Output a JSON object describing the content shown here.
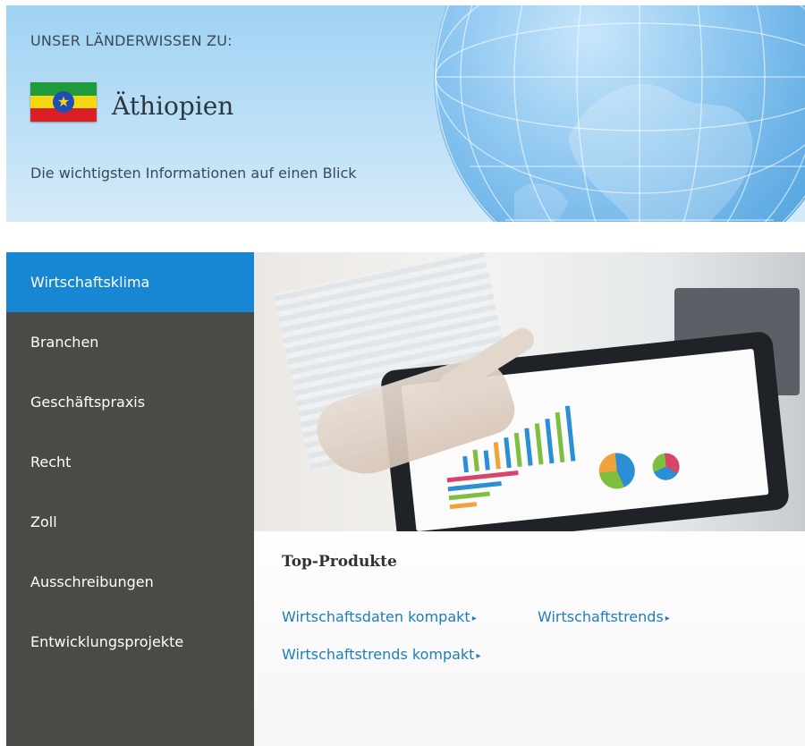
{
  "header": {
    "subheading": "UNSER LÄNDERWISSEN ZU:",
    "country": "Äthiopien",
    "tagline": "Die wichtigsten Informationen auf einen Blick",
    "flag_icon": "ethiopia-flag-icon",
    "globe_icon": "globe-icon"
  },
  "sidebar": {
    "items": [
      {
        "label": "Wirtschaftsklima",
        "active": true
      },
      {
        "label": "Branchen"
      },
      {
        "label": "Geschäftspraxis"
      },
      {
        "label": "Recht"
      },
      {
        "label": "Zoll"
      },
      {
        "label": "Ausschreibungen"
      },
      {
        "label": "Entwicklungsprojekte"
      }
    ]
  },
  "products": {
    "title": "Top-Produkte",
    "links": [
      {
        "label": "Wirtschaftsdaten kompakt",
        "arrow": "▸"
      },
      {
        "label": "Wirtschaftstrends",
        "arrow": "▸"
      },
      {
        "label": "Wirtschaftstrends kompakt",
        "arrow": "▸"
      }
    ]
  },
  "colors": {
    "accent": "#1887d3",
    "sidebar_bg": "#4a4a47",
    "link": "#1f7db8"
  }
}
